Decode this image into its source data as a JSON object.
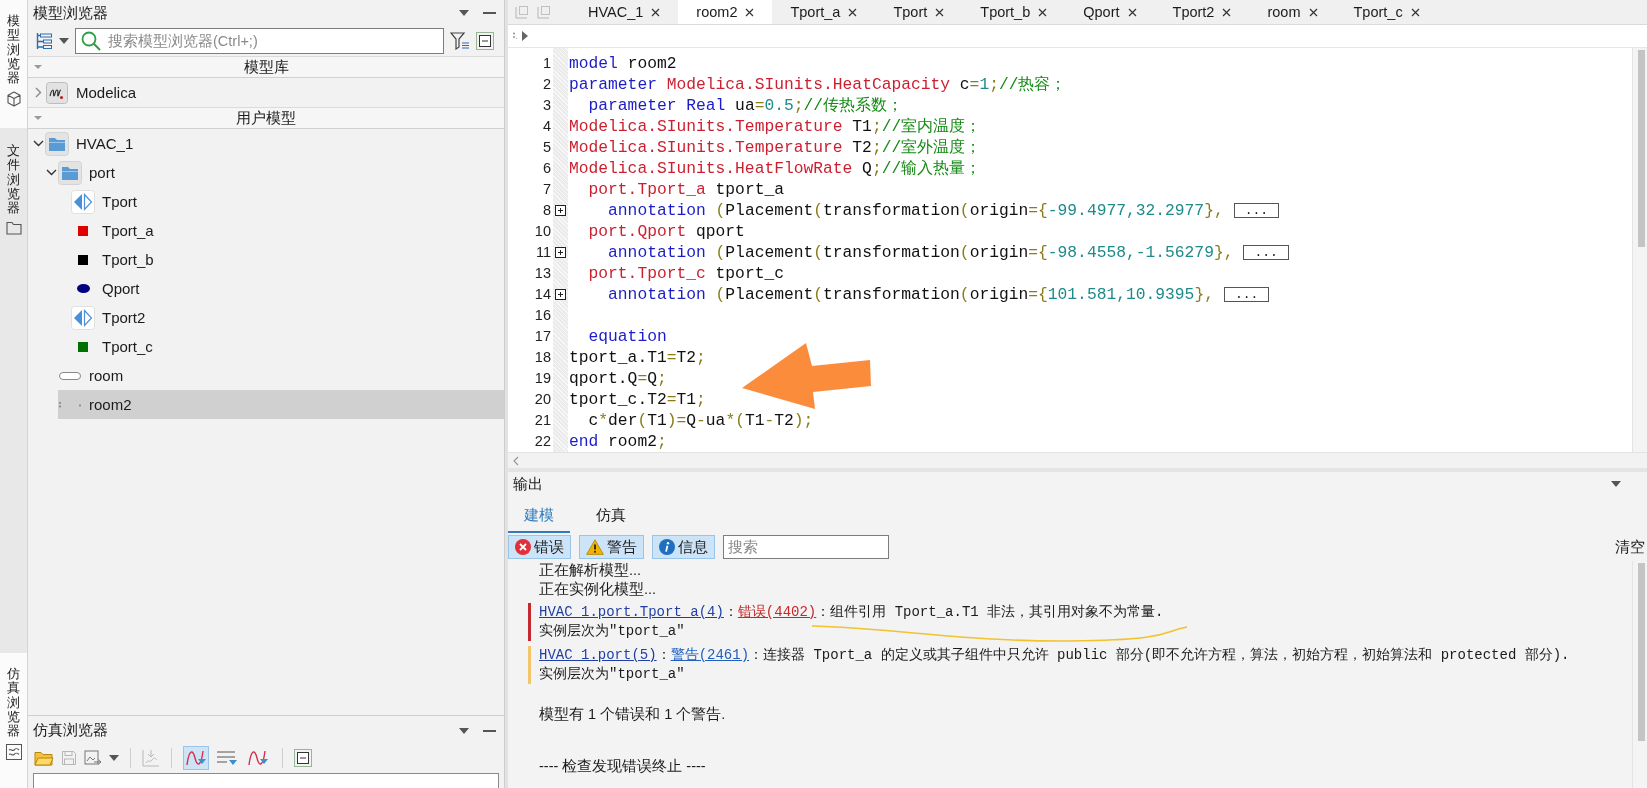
{
  "side_tabs": {
    "top": [
      {
        "label": "模型浏览器",
        "selected": true
      },
      {
        "label": "文件浏览器",
        "selected": false
      }
    ],
    "bottom": [
      {
        "label": "仿真浏览器",
        "selected": true
      }
    ]
  },
  "model_browser": {
    "title": "模型浏览器",
    "search": {
      "placeholder": "搜索模型浏览器(Ctrl+;)"
    },
    "sections": [
      {
        "title": "模型库",
        "expanded": true,
        "items": [
          {
            "label": "Modelica",
            "kind": "library",
            "expanded": false,
            "selected": false
          }
        ]
      },
      {
        "title": "用户模型",
        "expanded": true,
        "items": [
          {
            "label": "HVAC_1",
            "kind": "package",
            "expanded": true,
            "selected": false,
            "children": [
              {
                "label": "port",
                "kind": "package",
                "expanded": true,
                "selected": false,
                "children": [
                  {
                    "label": "Tport",
                    "kind": "connector",
                    "selected": false
                  },
                  {
                    "label": "Tport_a",
                    "kind": "square",
                    "color": "#e00000",
                    "selected": false
                  },
                  {
                    "label": "Tport_b",
                    "kind": "square",
                    "color": "#000000",
                    "selected": false
                  },
                  {
                    "label": "Qport",
                    "kind": "oval",
                    "color": "#000080",
                    "selected": false
                  },
                  {
                    "label": "Tport2",
                    "kind": "connector",
                    "selected": false
                  },
                  {
                    "label": "Tport_c",
                    "kind": "square",
                    "color": "#007000",
                    "selected": false
                  }
                ]
              },
              {
                "label": "room",
                "kind": "model",
                "selected": false
              },
              {
                "label": "room2",
                "kind": "blank",
                "selected": true
              }
            ]
          }
        ]
      }
    ]
  },
  "sim_browser": {
    "title": "仿真浏览器",
    "toolbar": [
      [
        {
          "disabled": false,
          "selected": false
        },
        {
          "disabled": true,
          "selected": false
        },
        {
          "disabled": false,
          "selected": false
        }
      ],
      [
        {
          "disabled": true,
          "selected": false
        }
      ],
      [
        {
          "disabled": false,
          "selected": true
        },
        {
          "disabled": false,
          "selected": false
        },
        {
          "disabled": false,
          "selected": false
        }
      ],
      [
        {
          "disabled": false,
          "selected": false
        }
      ]
    ]
  },
  "editor": {
    "tabs": [
      {
        "label": "HVAC_1",
        "selected": false
      },
      {
        "label": "room2",
        "selected": true
      },
      {
        "label": "Tport_a",
        "selected": false
      },
      {
        "label": "Tport",
        "selected": false
      },
      {
        "label": "Tport_b",
        "selected": false
      },
      {
        "label": "Qport",
        "selected": false
      },
      {
        "label": "Tport2",
        "selected": false
      },
      {
        "label": "room",
        "selected": false
      },
      {
        "label": "Tport_c",
        "selected": false
      }
    ],
    "lines": [
      {
        "number": "1",
        "folded": false,
        "tokens": [
          {
            "kind": "keyword",
            "text": "model"
          },
          {
            "kind": "plain",
            "text": " room2"
          }
        ]
      },
      {
        "number": "2",
        "folded": false,
        "tokens": [
          {
            "kind": "keyword",
            "text": "parameter "
          },
          {
            "kind": "type",
            "text": "Modelica.SIunits.HeatCapacity"
          },
          {
            "kind": "plain",
            "text": " c"
          },
          {
            "kind": "operator",
            "text": "="
          },
          {
            "kind": "number",
            "text": "1"
          },
          {
            "kind": "operator",
            "text": ";"
          },
          {
            "kind": "comment",
            "text": "//热容；"
          }
        ]
      },
      {
        "number": "3",
        "folded": false,
        "tokens": [
          {
            "kind": "keyword",
            "text": "  parameter "
          },
          {
            "kind": "keyword",
            "text": "Real"
          },
          {
            "kind": "plain",
            "text": " ua"
          },
          {
            "kind": "operator",
            "text": "="
          },
          {
            "kind": "number",
            "text": "0.5"
          },
          {
            "kind": "operator",
            "text": ";"
          },
          {
            "kind": "comment",
            "text": "//传热系数；"
          }
        ]
      },
      {
        "number": "4",
        "folded": false,
        "tokens": [
          {
            "kind": "type",
            "text": "Modelica.SIunits.Temperature"
          },
          {
            "kind": "plain",
            "text": " T1"
          },
          {
            "kind": "operator",
            "text": ";"
          },
          {
            "kind": "comment",
            "text": "//室内温度；"
          }
        ]
      },
      {
        "number": "5",
        "folded": false,
        "tokens": [
          {
            "kind": "type",
            "text": "Modelica.SIunits.Temperature"
          },
          {
            "kind": "plain",
            "text": " T2"
          },
          {
            "kind": "operator",
            "text": ";"
          },
          {
            "kind": "comment",
            "text": "//室外温度；"
          }
        ]
      },
      {
        "number": "6",
        "folded": false,
        "tokens": [
          {
            "kind": "type",
            "text": "Modelica.SIunits.HeatFlowRate"
          },
          {
            "kind": "plain",
            "text": " Q"
          },
          {
            "kind": "operator",
            "text": ";"
          },
          {
            "kind": "comment",
            "text": "//输入热量；"
          }
        ]
      },
      {
        "number": "7",
        "folded": false,
        "tokens": [
          {
            "kind": "type",
            "text": "  port.Tport_a"
          },
          {
            "kind": "plain",
            "text": " tport_a"
          }
        ]
      },
      {
        "number": "8",
        "folded": true,
        "collapsed_text": "...",
        "tokens": [
          {
            "kind": "keyword",
            "text": "    annotation"
          },
          {
            "kind": "operator",
            "text": " ("
          },
          {
            "kind": "plain",
            "text": "Placement"
          },
          {
            "kind": "operator",
            "text": "("
          },
          {
            "kind": "plain",
            "text": "transformation"
          },
          {
            "kind": "operator",
            "text": "("
          },
          {
            "kind": "plain",
            "text": "origin"
          },
          {
            "kind": "operator",
            "text": "={"
          },
          {
            "kind": "number",
            "text": "-99.4977,32.2977"
          },
          {
            "kind": "operator",
            "text": "},"
          }
        ]
      },
      {
        "number": "10",
        "folded": false,
        "tokens": [
          {
            "kind": "type",
            "text": "  port.Qport"
          },
          {
            "kind": "plain",
            "text": " qport"
          }
        ]
      },
      {
        "number": "11",
        "folded": true,
        "collapsed_text": "...",
        "tokens": [
          {
            "kind": "keyword",
            "text": "    annotation"
          },
          {
            "kind": "operator",
            "text": " ("
          },
          {
            "kind": "plain",
            "text": "Placement"
          },
          {
            "kind": "operator",
            "text": "("
          },
          {
            "kind": "plain",
            "text": "transformation"
          },
          {
            "kind": "operator",
            "text": "("
          },
          {
            "kind": "plain",
            "text": "origin"
          },
          {
            "kind": "operator",
            "text": "={"
          },
          {
            "kind": "number",
            "text": "-98.4558,-1.56279"
          },
          {
            "kind": "operator",
            "text": "},"
          }
        ]
      },
      {
        "number": "13",
        "folded": false,
        "tokens": [
          {
            "kind": "type",
            "text": "  port.Tport_c"
          },
          {
            "kind": "plain",
            "text": " tport_c"
          }
        ]
      },
      {
        "number": "14",
        "folded": true,
        "collapsed_text": "...",
        "tokens": [
          {
            "kind": "keyword",
            "text": "    annotation"
          },
          {
            "kind": "operator",
            "text": " ("
          },
          {
            "kind": "plain",
            "text": "Placement"
          },
          {
            "kind": "operator",
            "text": "("
          },
          {
            "kind": "plain",
            "text": "transformation"
          },
          {
            "kind": "operator",
            "text": "("
          },
          {
            "kind": "plain",
            "text": "origin"
          },
          {
            "kind": "operator",
            "text": "={"
          },
          {
            "kind": "number",
            "text": "101.581,10.9395"
          },
          {
            "kind": "operator",
            "text": "},"
          }
        ]
      },
      {
        "number": "16",
        "folded": false
      },
      {
        "number": "17",
        "folded": false,
        "tokens": [
          {
            "kind": "keyword",
            "text": "  equation"
          }
        ]
      },
      {
        "number": "18",
        "folded": false,
        "tokens": [
          {
            "kind": "plain",
            "text": "tport_a.T1"
          },
          {
            "kind": "operator",
            "text": "="
          },
          {
            "kind": "plain",
            "text": "T2"
          },
          {
            "kind": "operator",
            "text": ";"
          }
        ]
      },
      {
        "number": "19",
        "folded": false,
        "tokens": [
          {
            "kind": "plain",
            "text": "qport.Q"
          },
          {
            "kind": "operator",
            "text": "="
          },
          {
            "kind": "plain",
            "text": "Q"
          },
          {
            "kind": "operator",
            "text": ";"
          }
        ]
      },
      {
        "number": "20",
        "folded": false,
        "tokens": [
          {
            "kind": "plain",
            "text": "tport_c.T2"
          },
          {
            "kind": "operator",
            "text": "="
          },
          {
            "kind": "plain",
            "text": "T1"
          },
          {
            "kind": "operator",
            "text": ";"
          }
        ]
      },
      {
        "number": "21",
        "folded": false,
        "tokens": [
          {
            "kind": "plain",
            "text": "  c"
          },
          {
            "kind": "operator",
            "text": "*"
          },
          {
            "kind": "plain",
            "text": "der"
          },
          {
            "kind": "operator",
            "text": "("
          },
          {
            "kind": "plain",
            "text": "T1"
          },
          {
            "kind": "operator",
            "text": ")="
          },
          {
            "kind": "plain",
            "text": "Q"
          },
          {
            "kind": "operator",
            "text": "-"
          },
          {
            "kind": "plain",
            "text": "ua"
          },
          {
            "kind": "operator",
            "text": "*("
          },
          {
            "kind": "plain",
            "text": "T1"
          },
          {
            "kind": "operator",
            "text": "-"
          },
          {
            "kind": "plain",
            "text": "T2"
          },
          {
            "kind": "operator",
            "text": ");"
          }
        ]
      },
      {
        "number": "22",
        "folded": false,
        "tokens": [
          {
            "kind": "keyword",
            "text": "end"
          },
          {
            "kind": "plain",
            "text": " room2"
          },
          {
            "kind": "operator",
            "text": ";"
          }
        ]
      }
    ]
  },
  "output": {
    "title": "输出",
    "tabs": [
      {
        "label": "建模",
        "selected": true
      },
      {
        "label": "仿真",
        "selected": false
      }
    ],
    "filters": [
      {
        "label": "错误",
        "selected": true
      },
      {
        "label": "警告",
        "selected": true
      },
      {
        "label": "信息",
        "selected": true
      }
    ],
    "search": {
      "placeholder": "搜索"
    },
    "clear_label": "清空",
    "messages": [
      {
        "kind": "status",
        "text": "正在解析模型..."
      },
      {
        "kind": "status",
        "text": "正在实例化模型..."
      },
      {
        "kind": "error",
        "source": "HVAC_1.port.Tport_a(4)",
        "separator": "：",
        "code": "错误(4402)",
        "message": "：组件引用 Tport_a.T1 非法，其引用对象不为常量.",
        "detail": "实例层次为\"tport_a\""
      },
      {
        "kind": "warning",
        "source": "HVAC_1.port(5)",
        "separator": "：",
        "code": "警告(2461)",
        "message": "：连接器 Tport_a 的定义或其子组件中只允许 public 部分(即不允许方程，算法，初始方程，初始算法和 protected 部分).",
        "detail": "实例层次为\"tport_a\""
      },
      {
        "kind": "summary",
        "text": "模型有 1 个错误和 1 个警告."
      },
      {
        "kind": "end",
        "text": "---- 检查发现错误终止 ----"
      }
    ]
  }
}
